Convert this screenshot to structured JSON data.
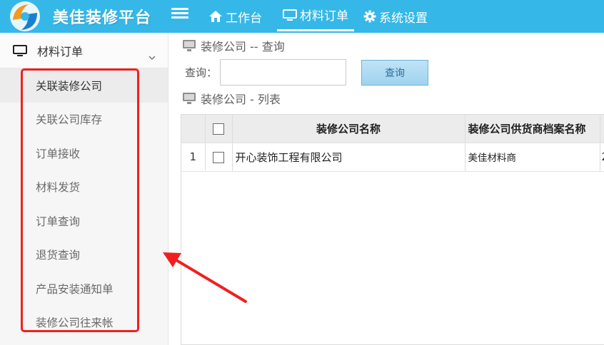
{
  "app": {
    "title": "美佳装修平台"
  },
  "topnav": {
    "items": [
      {
        "label": "工作台",
        "icon": "home-icon"
      },
      {
        "label": "材料订单",
        "icon": "monitor-icon",
        "active": true
      },
      {
        "label": "系统设置",
        "icon": "gear-icon"
      }
    ]
  },
  "sidebar": {
    "header": "材料订单",
    "items": [
      {
        "label": "关联装修公司",
        "active": true
      },
      {
        "label": "关联公司库存"
      },
      {
        "label": "订单接收"
      },
      {
        "label": "材料发货"
      },
      {
        "label": "订单查询"
      },
      {
        "label": "退货查询"
      },
      {
        "label": "产品安装通知单"
      },
      {
        "label": "装修公司往来帐"
      }
    ]
  },
  "query_section": {
    "title": "装修公司 -- 查询",
    "label": "查询：",
    "input_value": "",
    "button": "查询"
  },
  "list_section": {
    "title": "装修公司 - 列表",
    "columns": [
      "装修公司名称",
      "装修公司供货商档案名称"
    ],
    "rows": [
      {
        "index": "1",
        "company": "开心装饰工程有限公司",
        "supplier": "美佳材料商",
        "extra": "2"
      }
    ]
  },
  "colors": {
    "topbar": "#35b8e8",
    "annotation": "#f02020"
  }
}
